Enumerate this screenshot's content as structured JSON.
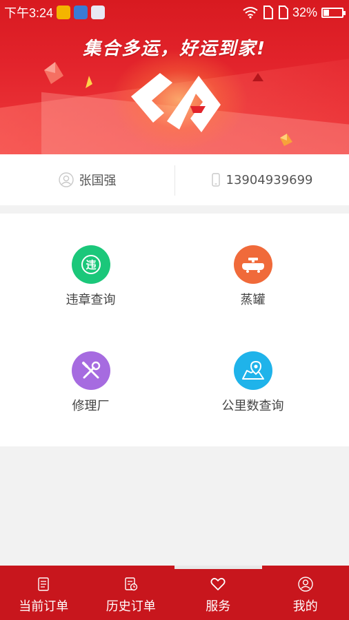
{
  "status_bar": {
    "time": "下午3:24",
    "battery_text": "32%",
    "battery_level": 0.32
  },
  "banner": {
    "slogan": "集合多运，好运到家!"
  },
  "user": {
    "name": "张国强",
    "phone": "13904939699"
  },
  "services": [
    {
      "label": "违章查询",
      "icon": "violation-icon",
      "color": "#1bc77a",
      "glyph": "违"
    },
    {
      "label": "蒸罐",
      "icon": "tank-icon",
      "color": "#f06a3a"
    },
    {
      "label": "修理厂",
      "icon": "repair-tools-icon",
      "color": "#a66be0"
    },
    {
      "label": "公里数查询",
      "icon": "map-location-icon",
      "color": "#1fb3ea"
    }
  ],
  "tabs": [
    {
      "label": "当前订单",
      "icon": "document-icon"
    },
    {
      "label": "历史订单",
      "icon": "history-document-icon"
    },
    {
      "label": "服务",
      "icon": "heart-icon",
      "active": true
    },
    {
      "label": "我的",
      "icon": "user-icon"
    }
  ],
  "colors": {
    "brand_red": "#c8161d",
    "banner_red": "#e2232b"
  }
}
